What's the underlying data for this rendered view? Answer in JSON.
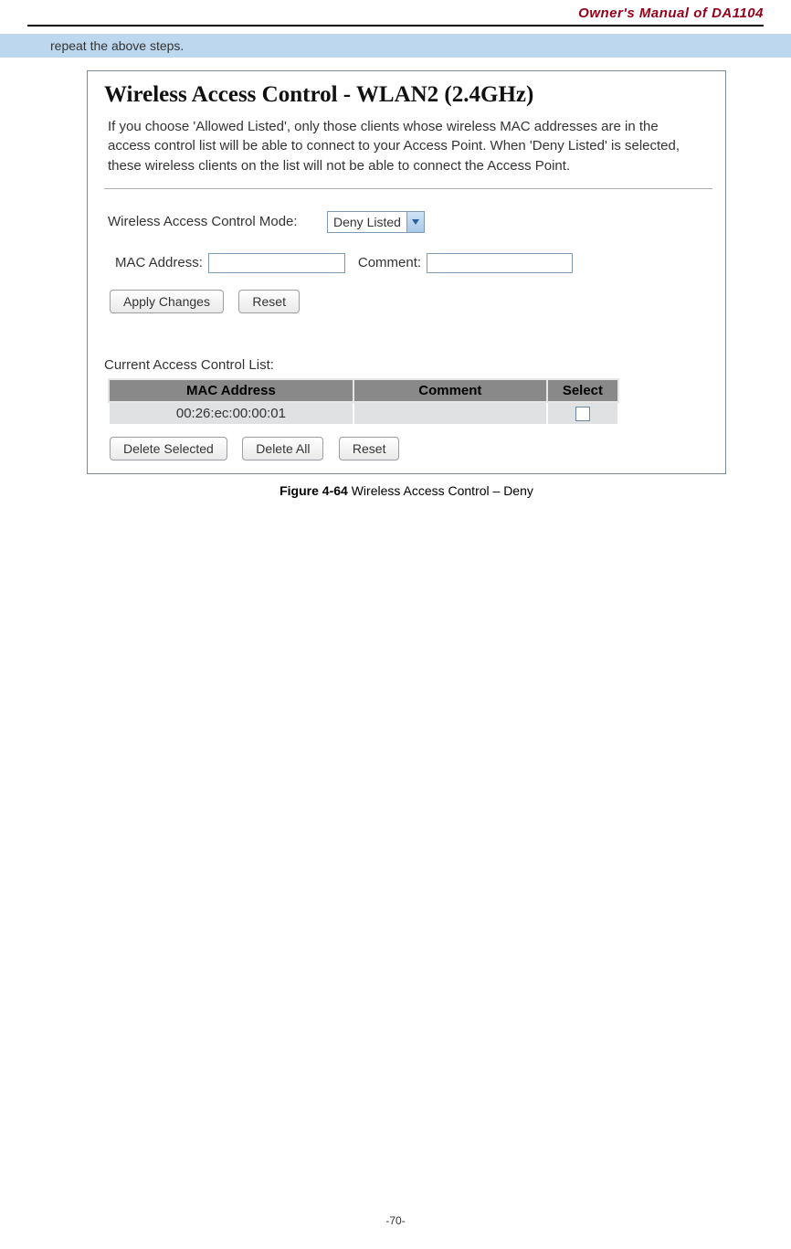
{
  "header": {
    "title": "Owner's Manual of DA1104"
  },
  "bluebar": {
    "text": "repeat the above steps."
  },
  "figure": {
    "title": "Wireless Access Control - WLAN2 (2.4GHz)",
    "description": "If you choose 'Allowed Listed', only those clients whose wireless MAC addresses are in the access control list will be able to connect to your Access Point. When 'Deny Listed' is selected, these wireless clients on the list will not be able to connect the Access Point.",
    "mode_label": "Wireless Access Control Mode:",
    "mode_value": "Deny Listed",
    "mac_label": "MAC Address:",
    "mac_value": "",
    "comment_label": "Comment:",
    "comment_value": "",
    "apply_button": "Apply Changes",
    "reset_button": "Reset",
    "current_list_label": "Current Access Control List:",
    "table": {
      "headers": [
        "MAC Address",
        "Comment",
        "Select"
      ],
      "rows": [
        {
          "mac": "00:26:ec:00:00:01",
          "comment": "",
          "selected": false
        }
      ]
    },
    "delete_selected_button": "Delete Selected",
    "delete_all_button": "Delete All",
    "reset2_button": "Reset"
  },
  "caption": {
    "bold": "Figure 4-64 ",
    "rest": "Wireless Access Control – Deny"
  },
  "footer": {
    "page": "-70-"
  }
}
